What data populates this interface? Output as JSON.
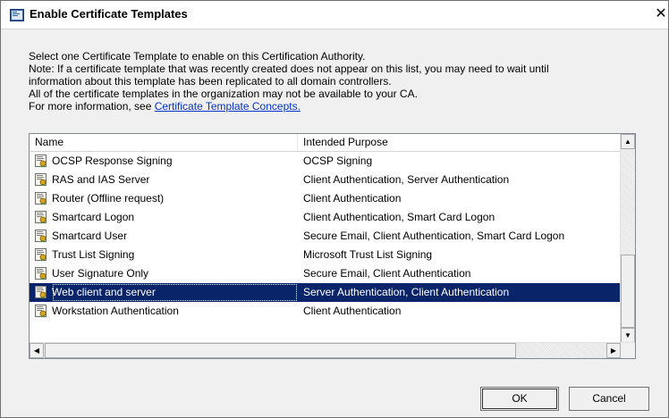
{
  "window": {
    "title": "Enable Certificate Templates",
    "close_glyph": "✕"
  },
  "intro": {
    "line1": "Select one Certificate Template to enable on this Certification Authority.",
    "line2": "Note: If a certificate template that was recently created does not appear on this list, you may need to wait until",
    "line3": "information about this template has been replicated to all domain controllers.",
    "line4": "All of the certificate templates in the organization may not be available to your CA.",
    "line5_prefix": "For more information, see ",
    "link": "Certificate Template Concepts."
  },
  "list": {
    "columns": [
      "Name",
      "Intended Purpose"
    ],
    "rows": [
      {
        "name": "OCSP Response Signing",
        "purpose": "OCSP Signing",
        "icon": "certificate-template-icon"
      },
      {
        "name": "RAS and IAS Server",
        "purpose": "Client Authentication, Server Authentication",
        "icon": "certificate-template-icon"
      },
      {
        "name": "Router (Offline request)",
        "purpose": "Client Authentication",
        "icon": "certificate-template-icon"
      },
      {
        "name": "Smartcard Logon",
        "purpose": "Client Authentication, Smart Card Logon",
        "icon": "certificate-template-icon"
      },
      {
        "name": "Smartcard User",
        "purpose": "Secure Email, Client Authentication, Smart Card Logon",
        "icon": "certificate-template-icon"
      },
      {
        "name": "Trust List Signing",
        "purpose": "Microsoft Trust List Signing",
        "icon": "certificate-template-icon"
      },
      {
        "name": "User Signature Only",
        "purpose": "Secure Email, Client Authentication",
        "icon": "certificate-template-icon"
      },
      {
        "name": "Web client and server",
        "purpose": "Server Authentication, Client Authentication",
        "icon": "certificate-template-icon",
        "selected": true
      },
      {
        "name": "Workstation Authentication",
        "purpose": "Client Authentication",
        "icon": "certificate-template-icon"
      }
    ],
    "selected_color": "#0a246a"
  },
  "buttons": {
    "ok": "OK",
    "cancel": "Cancel"
  },
  "scroll": {
    "up": "▲",
    "down": "▼",
    "left": "◀",
    "right": "▶"
  }
}
